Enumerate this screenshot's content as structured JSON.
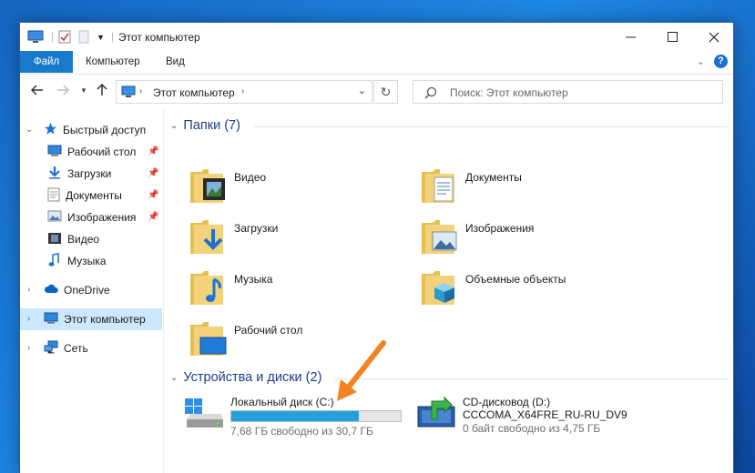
{
  "window": {
    "title": "Этот компьютер"
  },
  "ribbon": {
    "tabs": [
      "Файл",
      "Компьютер",
      "Вид"
    ]
  },
  "address": {
    "path": "Этот компьютер"
  },
  "search": {
    "placeholder": "Поиск: Этот компьютер"
  },
  "navpane": {
    "quick_access": "Быстрый доступ",
    "quick_items": [
      {
        "label": "Рабочий стол",
        "icon": "desktop-icon",
        "pinned": true
      },
      {
        "label": "Загрузки",
        "icon": "downloads-icon",
        "pinned": true
      },
      {
        "label": "Документы",
        "icon": "documents-icon",
        "pinned": true
      },
      {
        "label": "Изображения",
        "icon": "pictures-icon",
        "pinned": true
      },
      {
        "label": "Видео",
        "icon": "video-icon",
        "pinned": false
      },
      {
        "label": "Музыка",
        "icon": "music-icon",
        "pinned": false
      }
    ],
    "onedrive": "OneDrive",
    "this_pc": "Этот компьютер",
    "network": "Сеть"
  },
  "content": {
    "folders_header": "Папки (7)",
    "folders": [
      {
        "name": "Видео",
        "icon": "video-folder-icon"
      },
      {
        "name": "Документы",
        "icon": "documents-folder-icon"
      },
      {
        "name": "Загрузки",
        "icon": "downloads-folder-icon"
      },
      {
        "name": "Изображения",
        "icon": "pictures-folder-icon"
      },
      {
        "name": "Музыка",
        "icon": "music-folder-icon"
      },
      {
        "name": "Объемные объекты",
        "icon": "3d-objects-folder-icon"
      },
      {
        "name": "Рабочий стол",
        "icon": "desktop-folder-icon"
      }
    ],
    "drives_header": "Устройства и диски (2)",
    "drives": [
      {
        "name": "Локальный диск (C:)",
        "free": "7,68 ГБ свободно из 30,7 ГБ",
        "used_fraction": 0.75
      },
      {
        "name": "CD-дисковод (D:)",
        "label": "CCCOMA_X64FRE_RU-RU_DV9",
        "free": "0 байт свободно из 4,75 ГБ"
      }
    ]
  },
  "colors": {
    "accent": "#1979ca",
    "selection": "#cce8ff",
    "drive_bar": "#26a0da",
    "arrow": "#f58220"
  }
}
